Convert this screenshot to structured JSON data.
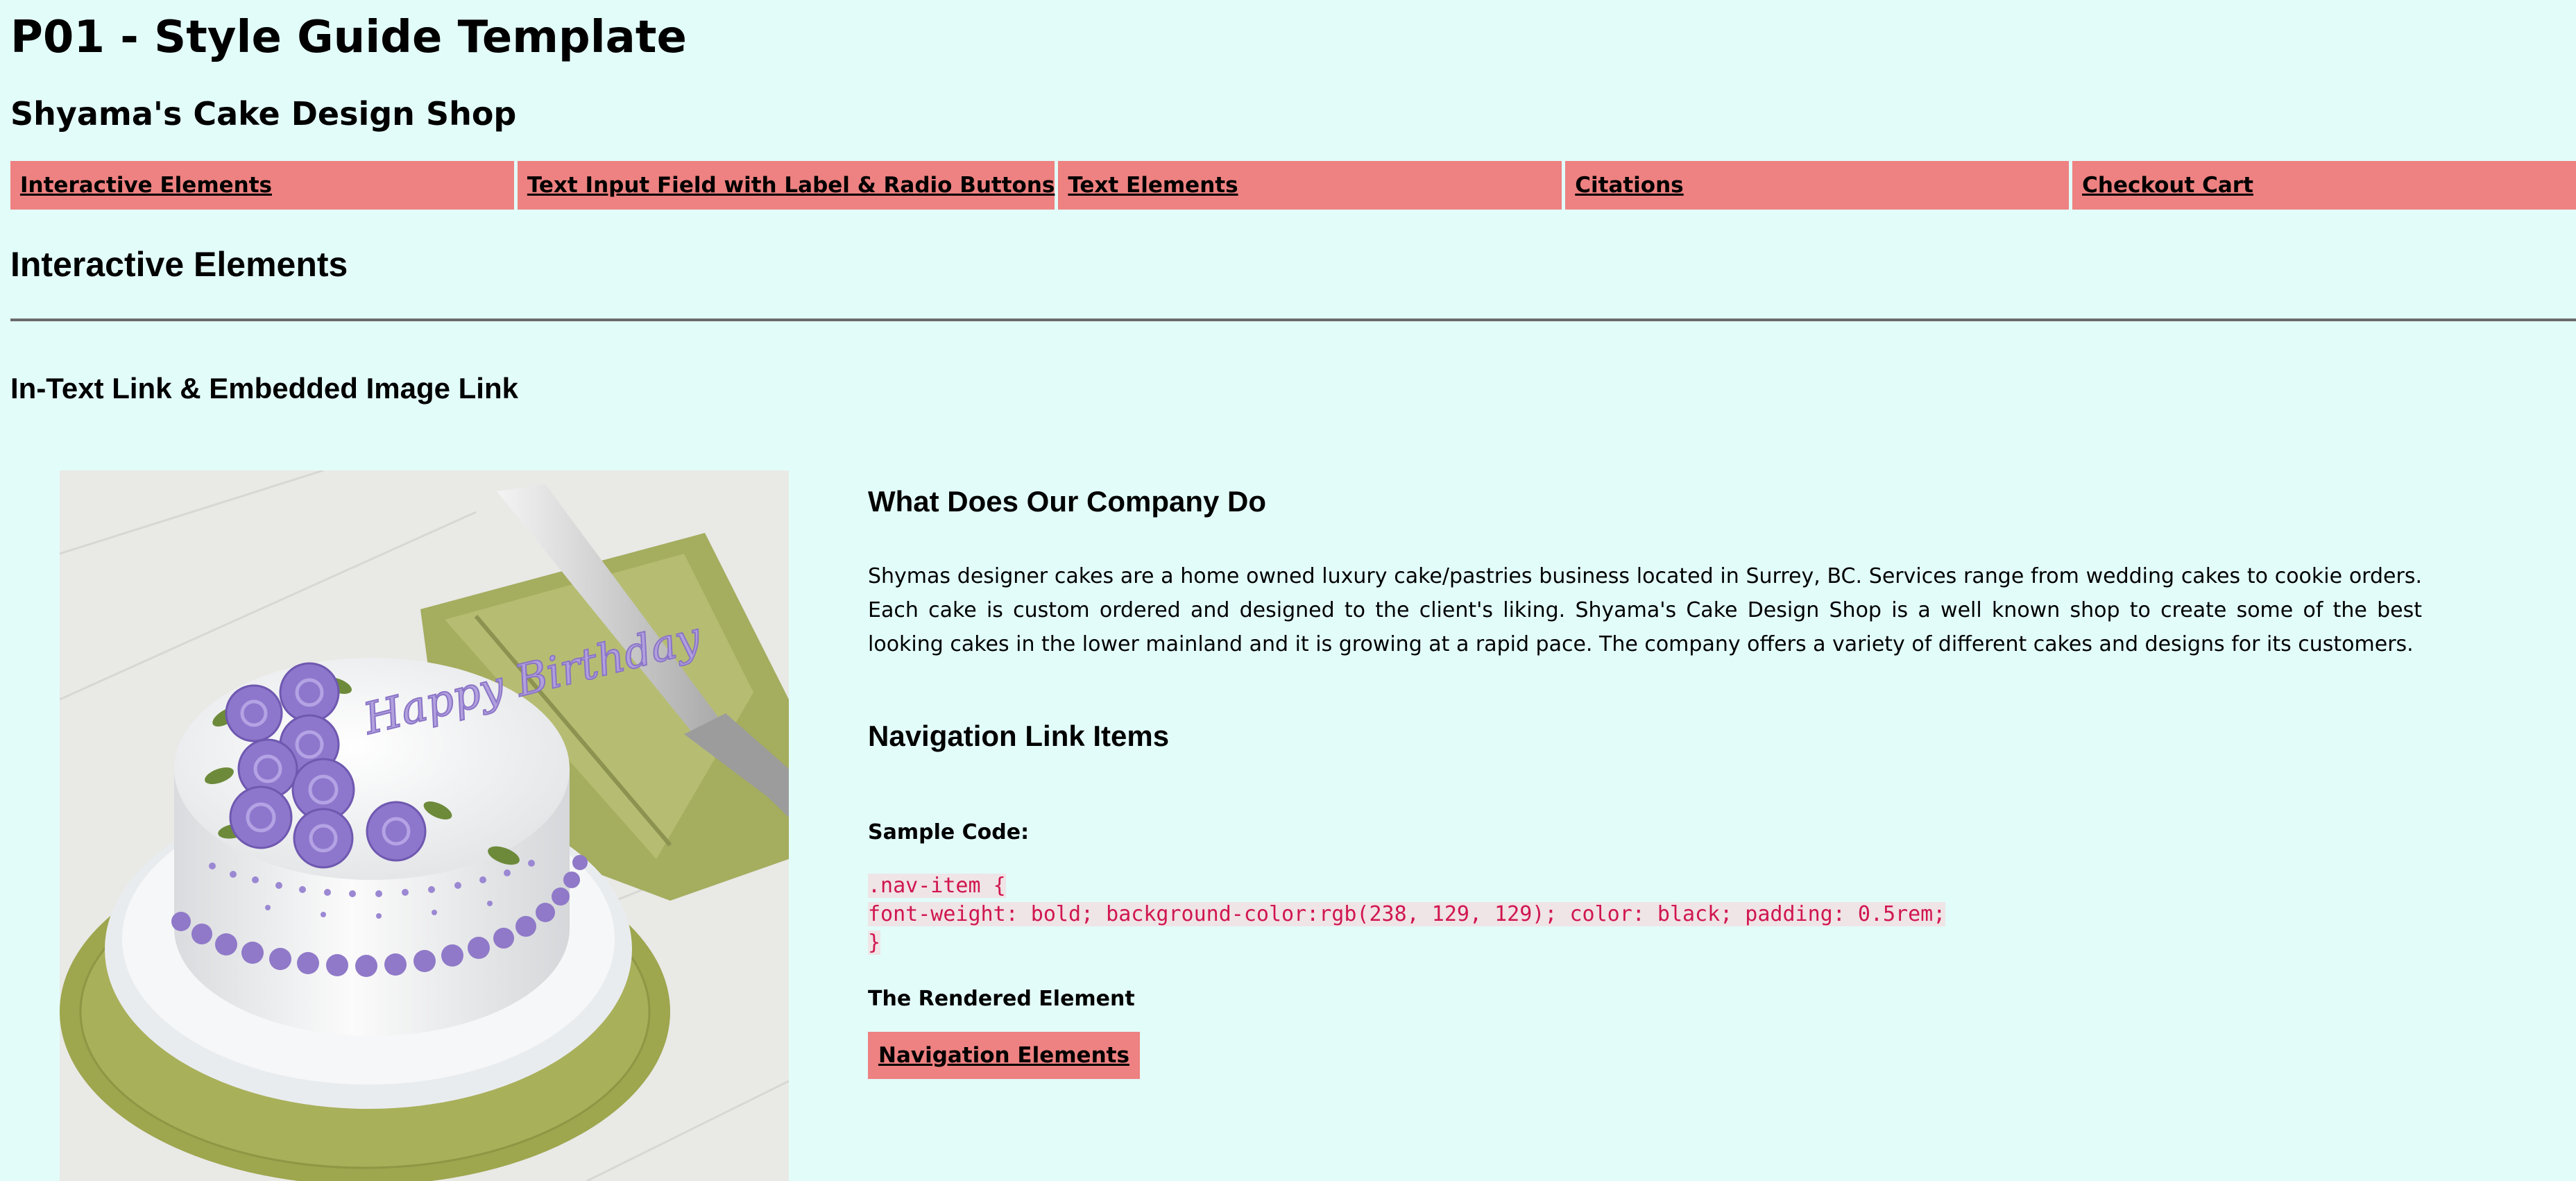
{
  "header": {
    "title": "P01 - Style Guide Template",
    "site_name": "Shyama's Cake Design Shop"
  },
  "nav": {
    "items": [
      {
        "label": "Interactive Elements"
      },
      {
        "label": "Text Input Field with Label & Radio Buttons"
      },
      {
        "label": "Text Elements"
      },
      {
        "label": "Citations"
      },
      {
        "label": "Checkout Cart"
      }
    ]
  },
  "main": {
    "section_title": "Interactive Elements",
    "subsection_title": "In-Text Link & Embedded Image Link",
    "company": {
      "heading": "What Does Our Company Do",
      "description": "Shymas designer cakes are a home owned luxury cake/pastries business located in Surrey, BC. Services range from wedding cakes to cookie orders. Each cake is custom ordered and designed to the client's liking. Shyama's Cake Design Shop is a well known shop to create some of the best looking cakes in the lower mainland and it is growing at a rapid pace. The company offers a variety of different cakes and designs for its customers."
    },
    "nav_links": {
      "heading": "Navigation Link Items",
      "sample_label": "Sample Code:",
      "code_lines": [
        ".nav-item {",
        "font-weight: bold; background-color:rgb(238, 129, 129); color: black; padding: 0.5rem;",
        "}"
      ],
      "rendered_label": "The Rendered Element",
      "rendered_button": "Navigation Elements"
    },
    "image": {
      "cake_text": "Happy Birthday"
    }
  },
  "colors": {
    "background": "#e2fcf9",
    "nav_item": "#ee8181",
    "code_text": "#d0164f"
  }
}
